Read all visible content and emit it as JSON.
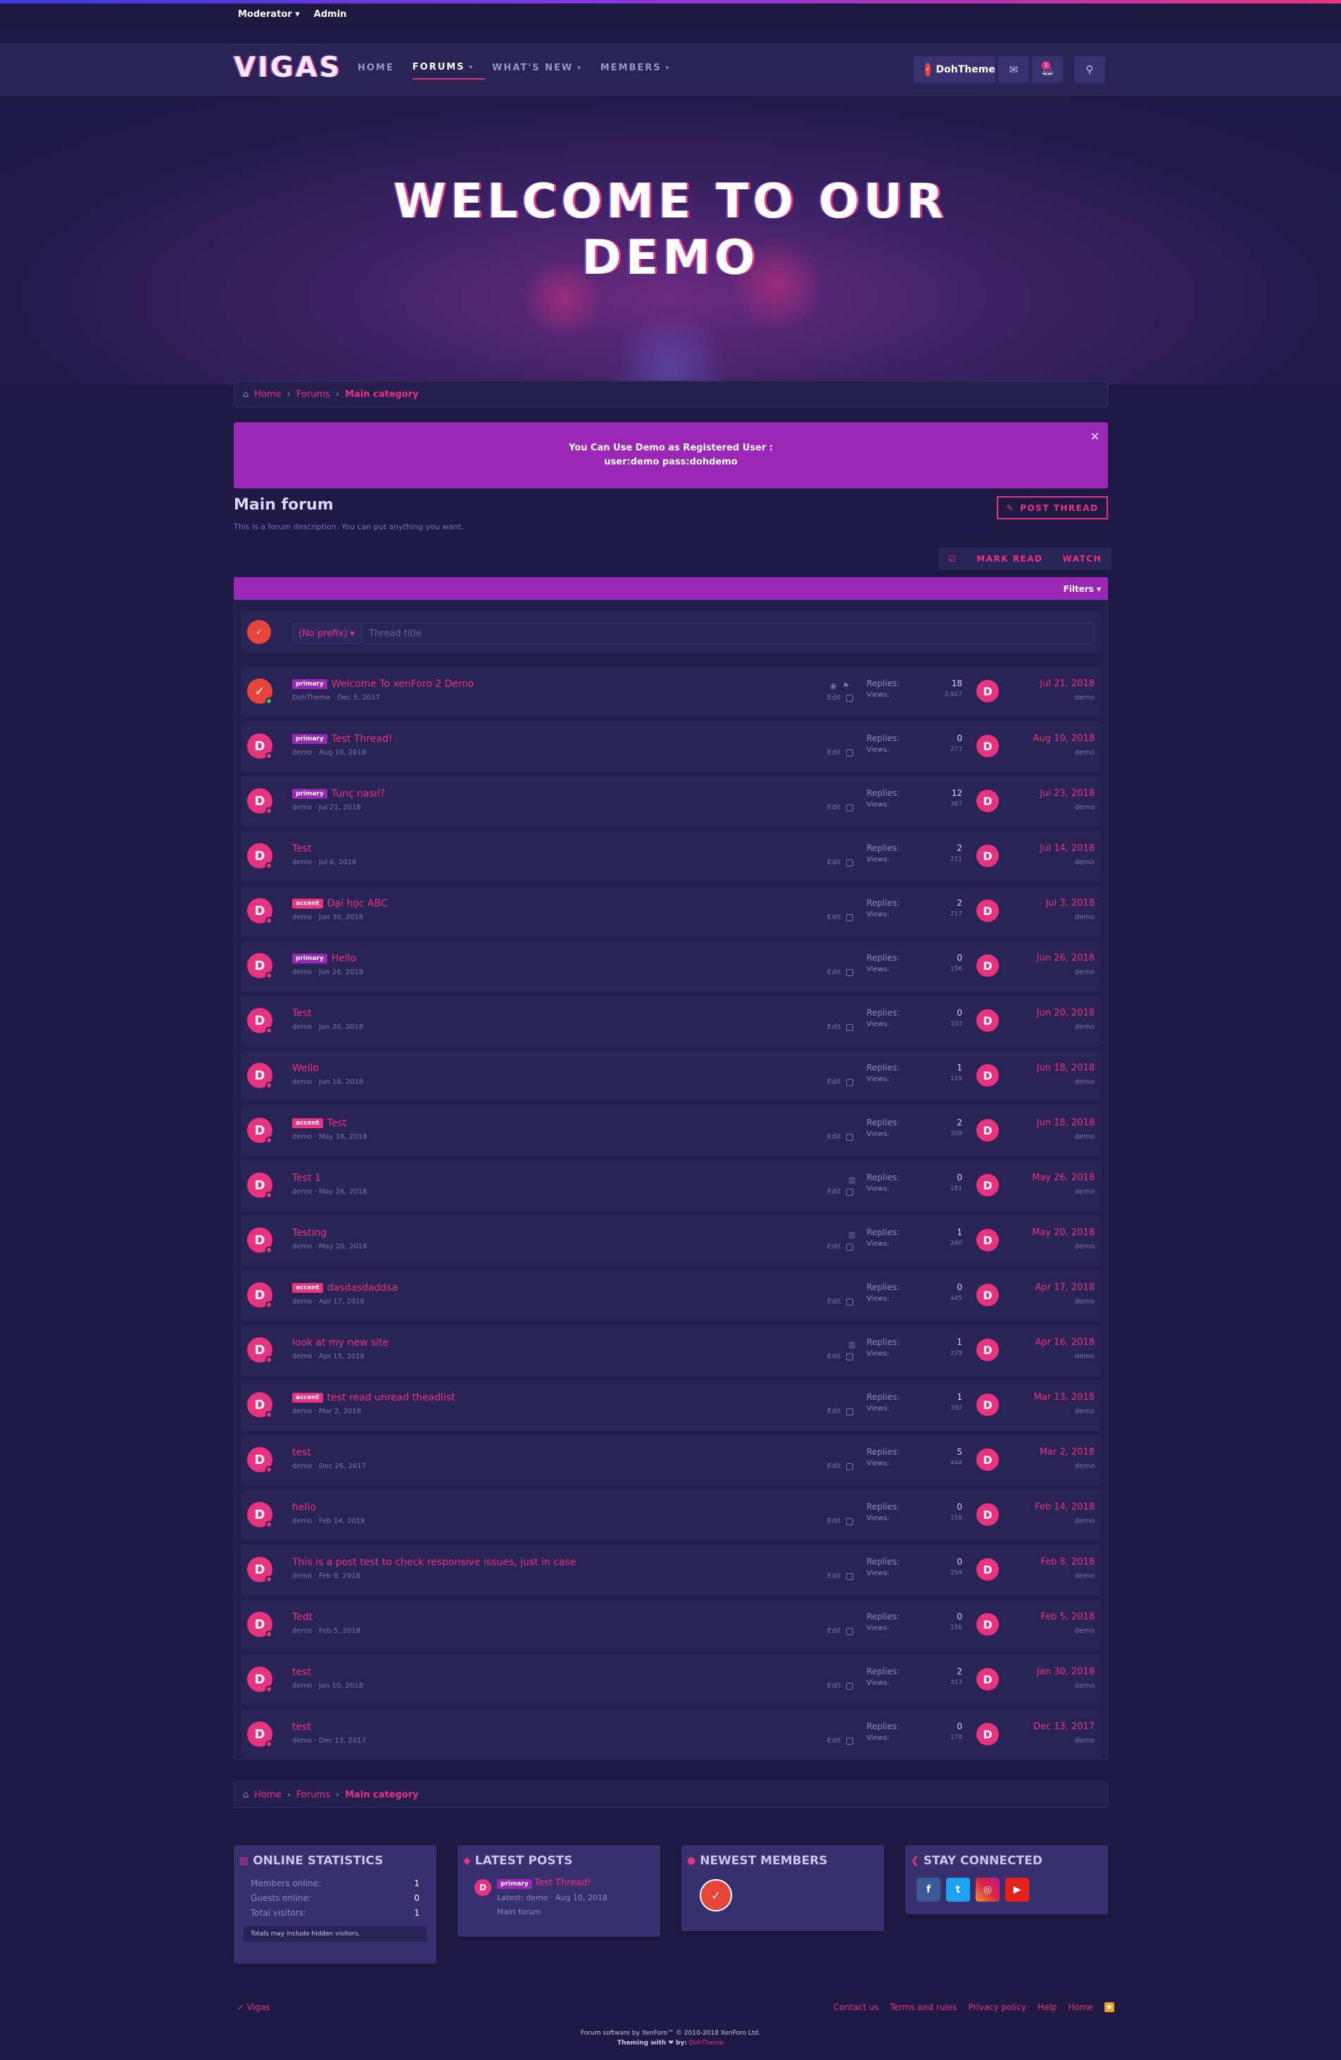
{
  "modbar": {
    "moderator": "Moderator ▾",
    "admin": "Admin"
  },
  "nav": {
    "logo": "VIGAS",
    "tabs": [
      {
        "label": "HOME",
        "caret": ""
      },
      {
        "label": "FORUMS",
        "caret": "▾"
      },
      {
        "label": "WHAT'S NEW",
        "caret": "▾"
      },
      {
        "label": "MEMBERS",
        "caret": "▾"
      }
    ],
    "user": "DohTheme",
    "alert_count": "1"
  },
  "hero": {
    "line1": "WELCOME TO OUR",
    "line2": "DEMO"
  },
  "breadcrumb": {
    "home": "Home",
    "forums": "Forums",
    "current": "Main category"
  },
  "notice": {
    "line1": "You Can Use Demo as Registered User :",
    "line2": "user:demo pass:dohdemo",
    "close": "×"
  },
  "forum": {
    "title": "Main forum",
    "description": "This is a forum description. You can put anything you want.",
    "post_thread": "POST THREAD",
    "mark_read": "MARK READ",
    "watch": "WATCH",
    "filters": "Filters ▾"
  },
  "quick_thread": {
    "prefix": "(No prefix) ▾",
    "placeholder": "Thread title"
  },
  "labels": {
    "replies": "Replies:",
    "views": "Views:",
    "edit": "Edit"
  },
  "threads": [
    {
      "prefix": "primary",
      "title": "Welcome To xenForo 2 Demo",
      "author": "DohTheme",
      "date": "Dec 5, 2017",
      "replies": "18",
      "views": "3,927",
      "last_date": "Jul 21, 2018",
      "last_user": "demo",
      "online": true,
      "watch": true
    },
    {
      "prefix": "primary",
      "title": "Test Thread!",
      "author": "demo",
      "date": "Aug 10, 2018",
      "replies": "0",
      "views": "273",
      "last_date": "Aug 10, 2018",
      "last_user": "demo"
    },
    {
      "prefix": "primary",
      "title": "Tunç nasıl?",
      "author": "demo",
      "date": "Jul 21, 2018",
      "replies": "12",
      "views": "387",
      "last_date": "Jul 23, 2018",
      "last_user": "demo"
    },
    {
      "prefix": "",
      "title": "Test",
      "author": "demo",
      "date": "Jul 6, 2018",
      "replies": "2",
      "views": "211",
      "last_date": "Jul 14, 2018",
      "last_user": "demo"
    },
    {
      "prefix": "accent",
      "title": "Đại học ABC",
      "author": "demo",
      "date": "Jun 30, 2018",
      "replies": "2",
      "views": "217",
      "last_date": "Jul 3, 2018",
      "last_user": "demo"
    },
    {
      "prefix": "primary",
      "title": "Hello",
      "author": "demo",
      "date": "Jun 26, 2018",
      "replies": "0",
      "views": "156",
      "last_date": "Jun 26, 2018",
      "last_user": "demo"
    },
    {
      "prefix": "",
      "title": "Test",
      "author": "demo",
      "date": "Jun 20, 2018",
      "replies": "0",
      "views": "103",
      "last_date": "Jun 20, 2018",
      "last_user": "demo"
    },
    {
      "prefix": "",
      "title": "Wello",
      "author": "demo",
      "date": "Jun 18, 2018",
      "replies": "1",
      "views": "119",
      "last_date": "Jun 18, 2018",
      "last_user": "demo"
    },
    {
      "prefix": "accent",
      "title": "Test",
      "author": "demo",
      "date": "May 18, 2018",
      "replies": "2",
      "views": "309",
      "last_date": "Jun 18, 2018",
      "last_user": "demo"
    },
    {
      "prefix": "",
      "title": "Test 1",
      "author": "demo",
      "date": "May 26, 2018",
      "replies": "0",
      "views": "181",
      "last_date": "May 26, 2018",
      "last_user": "demo",
      "poll": true
    },
    {
      "prefix": "",
      "title": "Testing",
      "author": "demo",
      "date": "May 20, 2018",
      "replies": "1",
      "views": "240",
      "last_date": "May 20, 2018",
      "last_user": "demo",
      "poll": true
    },
    {
      "prefix": "accent",
      "title": "dasdasdaddsa",
      "author": "demo",
      "date": "Apr 17, 2018",
      "replies": "0",
      "views": "445",
      "last_date": "Apr 17, 2018",
      "last_user": "demo"
    },
    {
      "prefix": "",
      "title": "look at my new site",
      "author": "demo",
      "date": "Apr 15, 2018",
      "replies": "1",
      "views": "229",
      "last_date": "Apr 16, 2018",
      "last_user": "demo",
      "poll": true
    },
    {
      "prefix": "accent",
      "title": "test read unread theadlist",
      "author": "demo",
      "date": "Mar 2, 2018",
      "replies": "1",
      "views": "392",
      "last_date": "Mar 13, 2018",
      "last_user": "demo"
    },
    {
      "prefix": "",
      "title": "test",
      "author": "demo",
      "date": "Dec 26, 2017",
      "replies": "5",
      "views": "444",
      "last_date": "Mar 2, 2018",
      "last_user": "demo"
    },
    {
      "prefix": "",
      "title": "hello",
      "author": "demo",
      "date": "Feb 14, 2018",
      "replies": "0",
      "views": "158",
      "last_date": "Feb 14, 2018",
      "last_user": "demo"
    },
    {
      "prefix": "",
      "title": "This is a post test to check responsive issues, just in case",
      "author": "demo",
      "date": "Feb 8, 2018",
      "replies": "0",
      "views": "254",
      "last_date": "Feb 8, 2018",
      "last_user": "demo"
    },
    {
      "prefix": "",
      "title": "Tedt",
      "author": "demo",
      "date": "Feb 5, 2018",
      "replies": "0",
      "views": "156",
      "last_date": "Feb 5, 2018",
      "last_user": "demo"
    },
    {
      "prefix": "",
      "title": "test",
      "author": "demo",
      "date": "Jan 10, 2018",
      "replies": "2",
      "views": "313",
      "last_date": "Jan 30, 2018",
      "last_user": "demo"
    },
    {
      "prefix": "",
      "title": "test",
      "author": "demo",
      "date": "Dec 13, 2017",
      "replies": "0",
      "views": "178",
      "last_date": "Dec 13, 2017",
      "last_user": "demo"
    }
  ],
  "widgets": {
    "online": {
      "title": "ONLINE STATISTICS",
      "members_label": "Members online:",
      "members": "1",
      "guests_label": "Guests online:",
      "guests": "0",
      "total_label": "Total visitors:",
      "total": "1",
      "hint": "Totals may include hidden visitors."
    },
    "latest": {
      "title": "LATEST POSTS",
      "prefix": "primary",
      "thread": "Test Thread!",
      "meta": "Latest: demo · Aug 10, 2018",
      "forum": "Main forum"
    },
    "members": {
      "title": "NEWEST MEMBERS"
    },
    "social": {
      "title": "STAY CONNECTED",
      "icons": [
        "f",
        "t",
        "◎",
        "▶"
      ]
    }
  },
  "footer": {
    "brand": "✓ Vigas",
    "links": [
      "Contact us",
      "Terms and rules",
      "Privacy policy",
      "Help",
      "Home"
    ],
    "rss": "◉",
    "copyright": "Forum software by XenForo™ © 2010-2018 XenForo Ltd.",
    "theming_prefix": "Theming with ❤ by:",
    "theming_by": "DohTheme"
  },
  "colors": {
    "accent": "#e8337f",
    "primary": "#9b27b6",
    "background": "#1f1a45"
  }
}
